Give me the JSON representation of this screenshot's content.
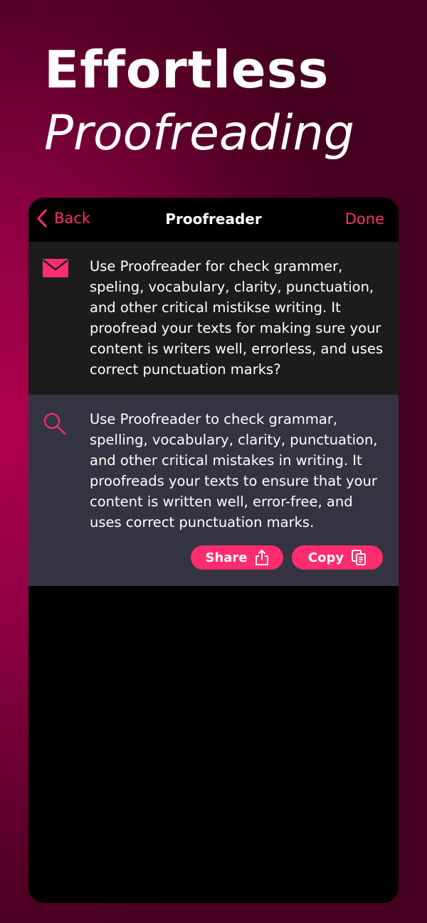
{
  "hero": {
    "line1": "Effortless",
    "line2": "Proofreading"
  },
  "nav": {
    "back_label": "Back",
    "title": "Proofreader",
    "done_label": "Done"
  },
  "input": {
    "icon": "envelope-icon",
    "text": "Use Proofreader for check grammer, speling, vocabulary, clarity, punctuation, and other critical mistikse writing. It proofread your texts for making sure your content is writers well, errorless, and uses correct punctuation marks?"
  },
  "output": {
    "icon": "search-icon",
    "text": "Use Proofreader to check grammar, spelling, vocabulary, clarity, punctuation, and other critical mistakes in writing. It proofreads your texts to ensure that your content is written well, error-free, and uses correct punctuation marks.",
    "share_label": "Share",
    "copy_label": "Copy"
  },
  "colors": {
    "accent": "#ff2d6f",
    "input_bg": "#1c1c1e",
    "output_bg": "#343440",
    "background": "#8a0042"
  }
}
